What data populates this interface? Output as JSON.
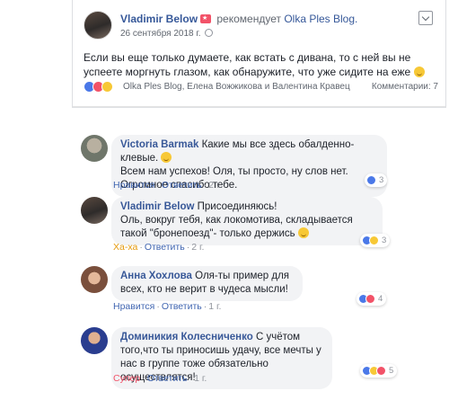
{
  "post": {
    "author": "Vladimir Below",
    "verb": "рекомендует",
    "page": "Olka Ples Blog.",
    "date": "26 сентября 2018 г.",
    "text": "Если вы еще только думаете, как встать с дивана, то с ней вы не успеете моргнуть глазом, как обнаружите, что уже сидите на еже",
    "likers": "Olka Ples Blog, Елена Вожжикова и Валентина Кравец",
    "comments_label": "Комментарии: 7",
    "avatar_icon": "user-photo",
    "recommend_icon": "recommend-star-icon",
    "reaction_icons": [
      "like-icon",
      "love-icon",
      "haha-icon"
    ]
  },
  "comments": [
    {
      "author": "Victoria Barmak",
      "text": "Какие мы все здесь обалденно-клевые.",
      "text2": "Всем нам успехов! Оля, ты просто, ну слов нет. Огромное спасибо тебе.",
      "action": "Нравится",
      "reply": "Ответить",
      "time": "2 г.",
      "count": "3",
      "avatar_color": "#8a8f88"
    },
    {
      "author": "Vladimir Below",
      "text": "Присоединяюсь!",
      "text2": "Оль, вокруг тебя, как локомотива, складывается такой \"бронепоезд\"- только держись",
      "action": "Ха-ха",
      "reply": "Ответить",
      "time": "2 г.",
      "count": "3",
      "avatar_color": "#4a4340"
    },
    {
      "author": "Анна Хохлова",
      "text": "Оля-ты пример для всех, кто не верит в чудеса мысли!",
      "action": "Нравится",
      "reply": "Ответить",
      "time": "1 г.",
      "count": "4",
      "avatar_color": "#b07a6a"
    },
    {
      "author": "Доминикия Колесниченко",
      "text": "С учётом того,что ты приносишь удачу, все мечты у нас в группе тоже обязательно осуществлятся!",
      "action": "Супер",
      "reply": "Ответить",
      "time": "1 г.",
      "count": "5",
      "avatar_color": "#2a3d8f"
    }
  ],
  "colors": {
    "link": "#365899",
    "like": "#4a78e8",
    "love": "#f25268",
    "haha": "#f7c836"
  }
}
